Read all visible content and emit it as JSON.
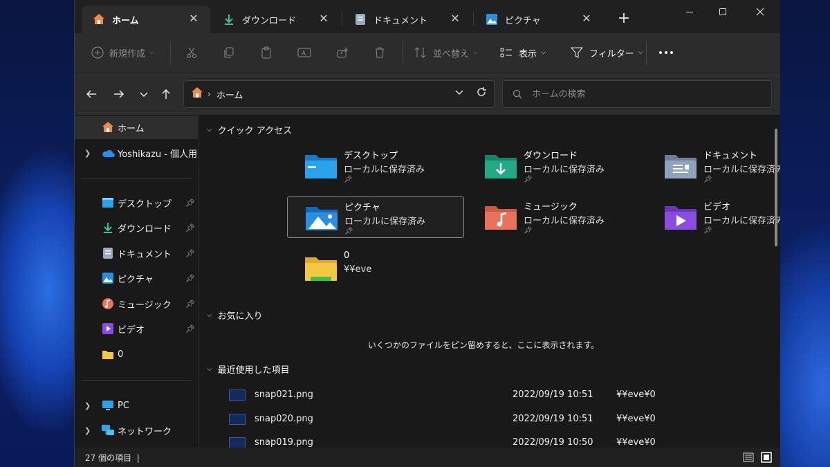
{
  "tabs": [
    {
      "label": "ホーム",
      "icon": "home-icon"
    },
    {
      "label": "ダウンロード",
      "icon": "download-icon"
    },
    {
      "label": "ドキュメント",
      "icon": "document-icon"
    },
    {
      "label": "ピクチャ",
      "icon": "pictures-icon"
    }
  ],
  "toolbar": {
    "new_label": "新規作成",
    "sort_label": "並べ替え",
    "view_label": "表示",
    "filter_label": "フィルター"
  },
  "address": {
    "location": "ホーム",
    "search_placeholder": "ホームの検索"
  },
  "sidebar": {
    "items": [
      {
        "label": "ホーム",
        "icon": "home-icon"
      },
      {
        "label": "Yoshikazu - 個人用",
        "icon": "onedrive-icon"
      },
      {
        "label": "デスクトップ",
        "icon": "desktop-icon"
      },
      {
        "label": "ダウンロード",
        "icon": "download-icon"
      },
      {
        "label": "ドキュメント",
        "icon": "document-icon"
      },
      {
        "label": "ピクチャ",
        "icon": "pictures-icon"
      },
      {
        "label": "ミュージック",
        "icon": "music-icon"
      },
      {
        "label": "ビデオ",
        "icon": "video-icon"
      },
      {
        "label": "0",
        "icon": "folder-icon"
      },
      {
        "label": "PC",
        "icon": "pc-icon"
      },
      {
        "label": "ネットワーク",
        "icon": "network-icon"
      }
    ]
  },
  "sections": {
    "quick_access": "クイック アクセス",
    "favorites": "お気に入り",
    "recent": "最近使用した項目"
  },
  "quick_access": [
    {
      "name": "デスクトップ",
      "sub": "ローカルに保存済み",
      "color": "#2aa3ea"
    },
    {
      "name": "ダウンロード",
      "sub": "ローカルに保存済み",
      "color": "#22a986"
    },
    {
      "name": "ドキュメント",
      "sub": "ローカルに保存済み",
      "color": "#8fa3bd"
    },
    {
      "name": "ピクチャ",
      "sub": "ローカルに保存済み",
      "color": "#2a8fe0"
    },
    {
      "name": "ミュージック",
      "sub": "ローカルに保存済み",
      "color": "#e8735a"
    },
    {
      "name": "ビデオ",
      "sub": "ローカルに保存済み",
      "color": "#8a4de0"
    },
    {
      "name": "0",
      "sub": "¥¥eve",
      "color": "#f5c842"
    }
  ],
  "favorites_empty": "いくつかのファイルをピン留めすると、ここに表示されます。",
  "recent": [
    {
      "name": "snap021.png",
      "date": "2022/09/19 10:51",
      "location": "¥¥eve¥0"
    },
    {
      "name": "snap020.png",
      "date": "2022/09/19 10:51",
      "location": "¥¥eve¥0"
    },
    {
      "name": "snap019.png",
      "date": "2022/09/19 10:50",
      "location": "¥¥eve¥0"
    }
  ],
  "status": {
    "count": "27 個の項目",
    "separator": "|"
  }
}
